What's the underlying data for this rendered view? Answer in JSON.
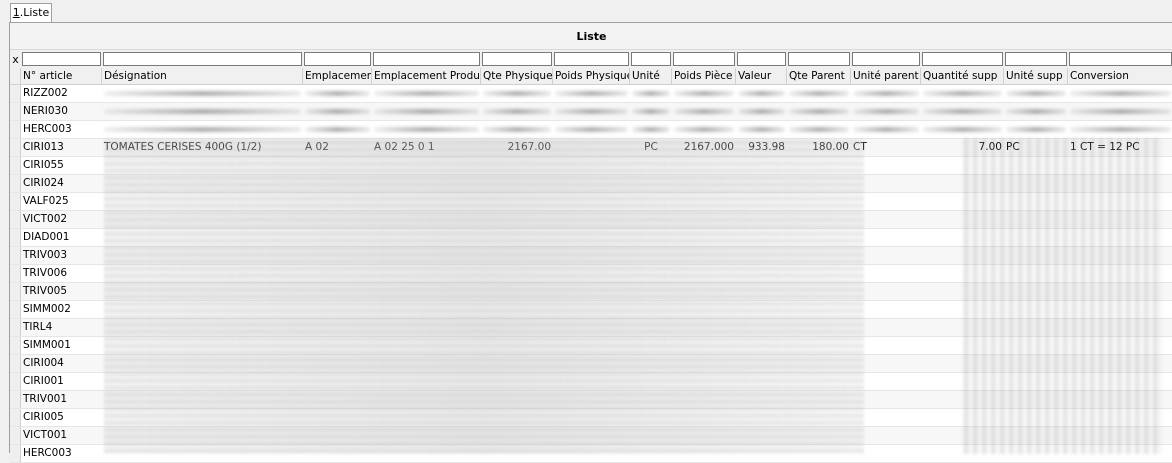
{
  "tab": {
    "label_hotkey": "1",
    "label_rest": ".Liste"
  },
  "grid": {
    "title": "Liste",
    "clear_filter": "x",
    "columns": [
      "N° article",
      "Désignation",
      "Emplacement",
      "Emplacement Produit",
      "Qte Physique",
      "Poids Physique",
      "Unité",
      "Poids Pièce",
      "Valeur",
      "Qte Parent",
      "Unité parent",
      "Quantité supp",
      "Unité supp",
      "Conversion"
    ],
    "rows": [
      {
        "article": "RIZZ002"
      },
      {
        "article": "NERI030"
      },
      {
        "article": "HERC003"
      },
      {
        "article": "CIRI013",
        "designation": "TOMATES CERISES 400G (1/2)",
        "emplacement": "A 02",
        "emplacement_produit": "A 02 25 0 1",
        "qte_physique": "2167.00",
        "poids_physique": "",
        "unite": "PC",
        "poids_piece": "2167.000",
        "valeur": "933.98",
        "qte_parent": "180.00",
        "unite_parent": "CT",
        "quantite_supp": "7.00",
        "unite_supp": "PC",
        "conversion": "1 CT = 12 PC"
      },
      {
        "article": "CIRI055"
      },
      {
        "article": "CIRI024"
      },
      {
        "article": "VALF025"
      },
      {
        "article": "VICT002"
      },
      {
        "article": "DIAD001"
      },
      {
        "article": "TRIV003"
      },
      {
        "article": "TRIV006"
      },
      {
        "article": "TRIV005"
      },
      {
        "article": "SIMM002"
      },
      {
        "article": "TIRL4"
      },
      {
        "article": "SIMM001"
      },
      {
        "article": "CIRI004"
      },
      {
        "article": "CIRI001"
      },
      {
        "article": "TRIV001"
      },
      {
        "article": "CIRI005"
      },
      {
        "article": "VICT001"
      },
      {
        "article": "HERC003"
      }
    ]
  }
}
